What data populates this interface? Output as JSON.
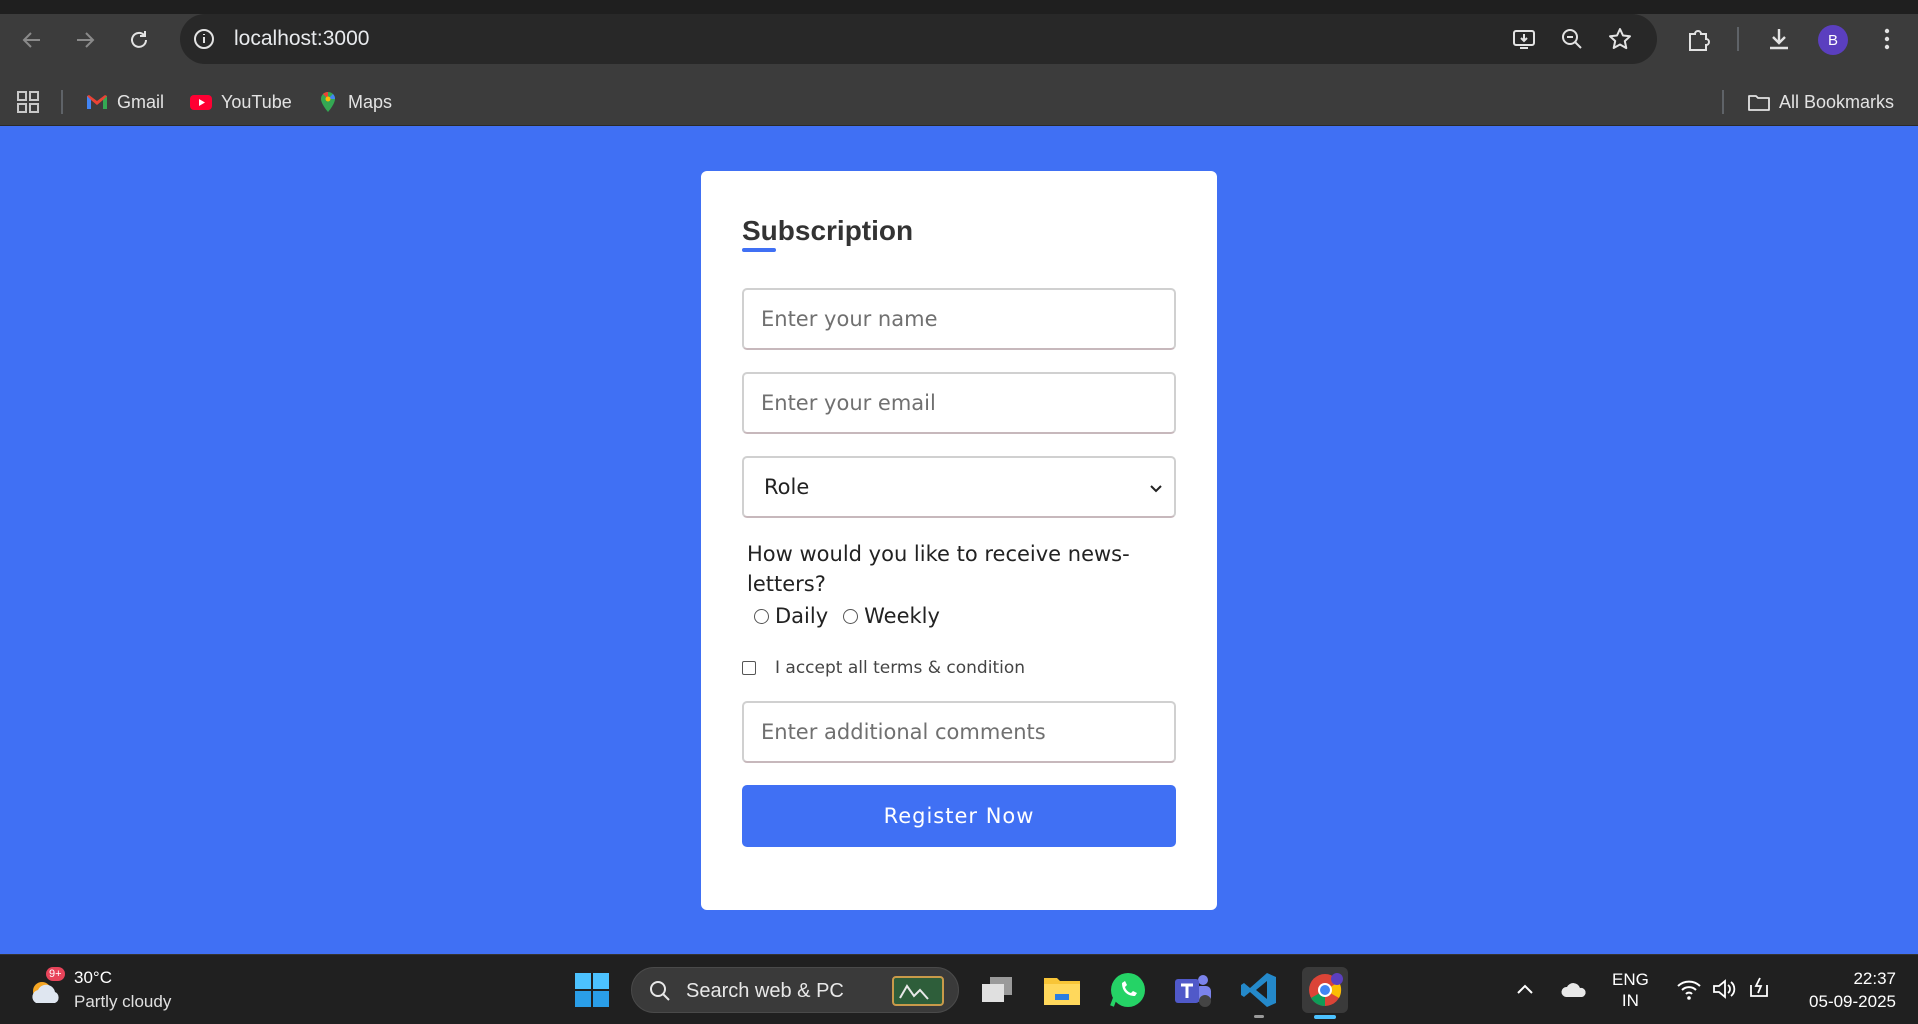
{
  "browser": {
    "url": "localhost:3000",
    "bookmarks": [
      {
        "label": "Gmail",
        "icon": "gmail-icon"
      },
      {
        "label": "YouTube",
        "icon": "youtube-icon"
      },
      {
        "label": "Maps",
        "icon": "maps-icon"
      }
    ],
    "all_bookmarks_label": "All Bookmarks",
    "profile_initial": "B"
  },
  "form": {
    "title": "Subscription",
    "name_placeholder": "Enter your name",
    "email_placeholder": "Enter your email",
    "role_selected": "Role",
    "question": "How would you like to receive news-letters?",
    "radio_options": [
      "Daily",
      "Weekly"
    ],
    "terms_label": "I accept all terms & condition",
    "comments_placeholder": "Enter additional comments",
    "submit_label": "Register Now",
    "accent_color": "#4070f4"
  },
  "taskbar": {
    "weather_temp": "30°C",
    "weather_condition": "Partly cloudy",
    "weather_badge": "9+",
    "search_placeholder": "Search web & PC",
    "language_line1": "ENG",
    "language_line2": "IN",
    "time": "22:37",
    "date": "05-09-2025"
  }
}
